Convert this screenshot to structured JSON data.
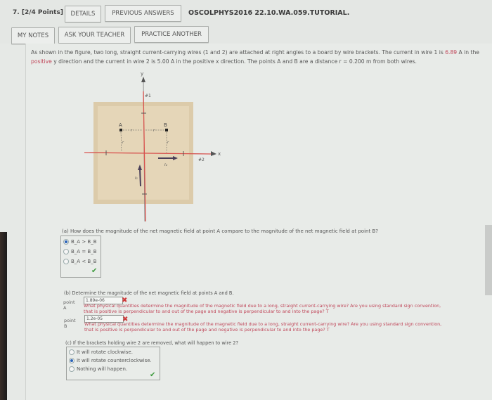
{
  "header": {
    "question_number": "7.",
    "points": "[2/4 Points]",
    "details_button": "DETAILS",
    "previous_answers_button": "PREVIOUS ANSWERS",
    "question_code": "OSCOLPHYS2016 22.10.WA.059.TUTORIAL.",
    "my_notes_button": "MY NOTES",
    "ask_teacher_button": "ASK YOUR TEACHER",
    "practice_another_button": "PRACTICE ANOTHER"
  },
  "problem": {
    "text_part1": "As shown in the figure, two long, straight current-carrying wires (1 and 2) are attached at right angles to a board by wire brackets. The current in wire 1 is ",
    "current_wire1": "6.89",
    "text_part2": " A in the",
    "text_positive": "positive",
    "text_part3": " y direction and the current in wire 2 is 5.00 A in the positive x direction. The points A and B are a distance r = 0.200 m from both wires."
  },
  "figure": {
    "y_label": "y",
    "x_label": "x",
    "wire1_label": "#1",
    "wire2_label": "#2",
    "point_a": "A",
    "point_b": "B",
    "r_label": "r",
    "i1_label": "I₁",
    "i2_label": "I₂"
  },
  "part_a": {
    "question": "(a) How does the magnitude of the net magnetic field at point A compare to the magnitude of the net magnetic field at point B?",
    "options": [
      {
        "label": "B_A > B_B",
        "selected": true
      },
      {
        "label": "B_A = B_B",
        "selected": false
      },
      {
        "label": "B_A < B_B",
        "selected": false
      }
    ],
    "status": "correct"
  },
  "part_b": {
    "question": "(b) Determine the magnitude of the net magnetic field at points A and B.",
    "point_a_label": "point A",
    "point_a_value": "1.89e-06",
    "point_a_status": "incorrect",
    "point_b_label": "point B",
    "point_b_value": "1.2e-05",
    "point_b_status": "incorrect",
    "hint_line1": "What physical quantities determine the magnitude of the magnetic field due to a long, straight current-carrying wire? Are you using standard sign convention,",
    "hint_line2": "that is positive is perpendicular to and out of the page and negative is perpendicular to and into the page? T"
  },
  "part_c": {
    "question": "(c) If the brackets holding wire 2 are removed, what will happen to wire 2?",
    "options": [
      {
        "label": "It will rotate clockwise.",
        "selected": false
      },
      {
        "label": "It will rotate counterclockwise.",
        "selected": true
      },
      {
        "label": "Nothing will happen.",
        "selected": false
      }
    ],
    "status": "correct"
  },
  "colors": {
    "hint_red": "#c0475a",
    "incorrect": "#d03a3a",
    "correct": "#3c9a3c",
    "selected_radio": "#2a63b8",
    "board": "#d9c8a8",
    "wire": "#d9534f"
  }
}
